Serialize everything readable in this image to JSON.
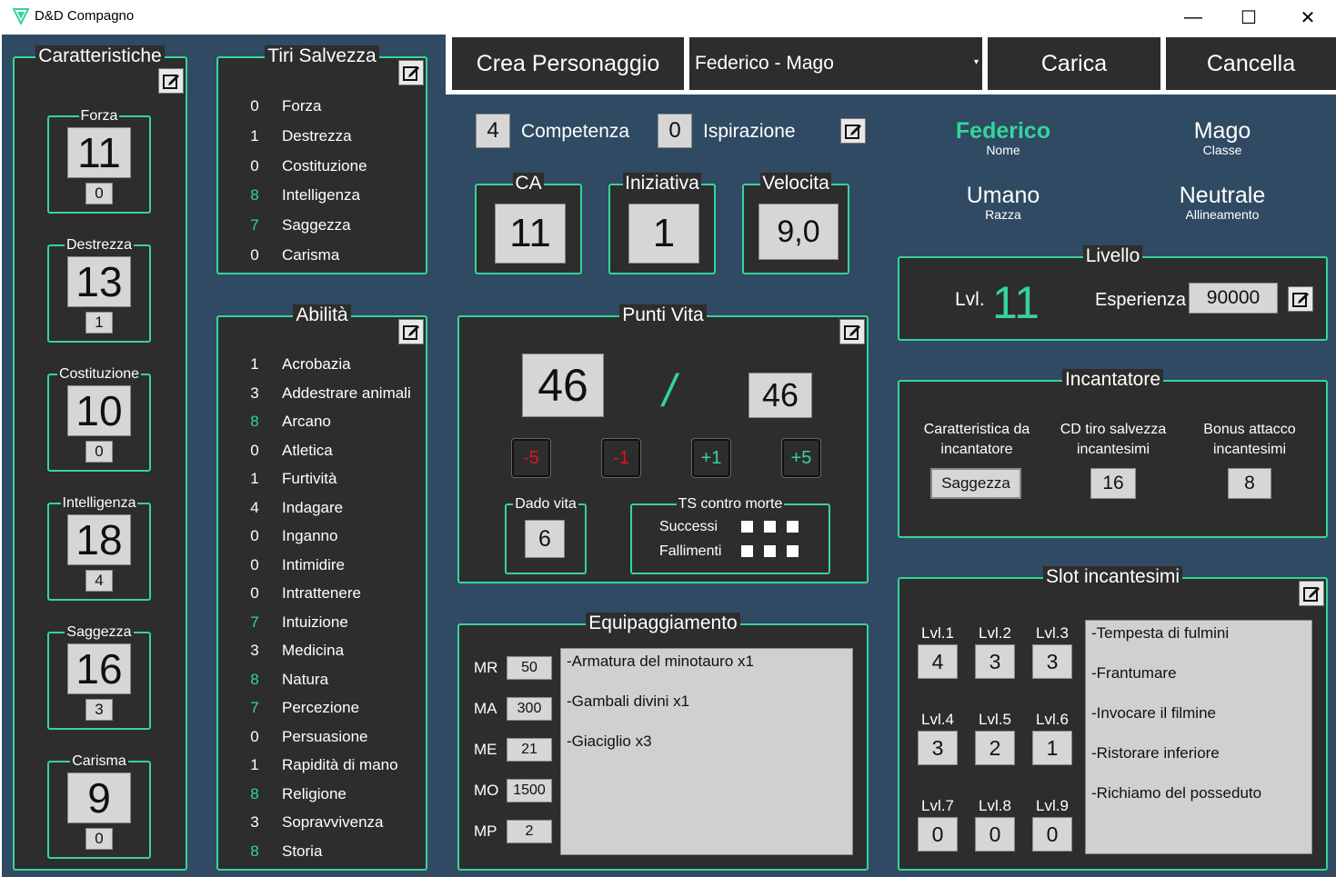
{
  "app": {
    "title": "D&D Compagno",
    "minimize": "—",
    "maximize": "☐",
    "close": "✕"
  },
  "colors": {
    "accent": "#35d49a",
    "background": "#2f4a62",
    "panel": "#2d2d2d",
    "negative": "#e0141b"
  },
  "caratteristiche": {
    "title": "Caratteristiche",
    "stats": [
      {
        "label": "Forza",
        "value": "11",
        "mod": "0"
      },
      {
        "label": "Destrezza",
        "value": "13",
        "mod": "1"
      },
      {
        "label": "Costituzione",
        "value": "10",
        "mod": "0"
      },
      {
        "label": "Intelligenza",
        "value": "18",
        "mod": "4"
      },
      {
        "label": "Saggezza",
        "value": "16",
        "mod": "3"
      },
      {
        "label": "Carisma",
        "value": "9",
        "mod": "0"
      }
    ]
  },
  "tiri_salvezza": {
    "title": "Tiri Salvezza",
    "items": [
      {
        "value": "0",
        "label": "Forza",
        "proficient": false
      },
      {
        "value": "1",
        "label": "Destrezza",
        "proficient": false
      },
      {
        "value": "0",
        "label": "Costituzione",
        "proficient": false
      },
      {
        "value": "8",
        "label": "Intelligenza",
        "proficient": true
      },
      {
        "value": "7",
        "label": "Saggezza",
        "proficient": true
      },
      {
        "value": "0",
        "label": "Carisma",
        "proficient": false
      }
    ]
  },
  "abilita": {
    "title": "Abilità",
    "items": [
      {
        "value": "1",
        "label": "Acrobazia",
        "proficient": false
      },
      {
        "value": "3",
        "label": "Addestrare animali",
        "proficient": false
      },
      {
        "value": "8",
        "label": "Arcano",
        "proficient": true
      },
      {
        "value": "0",
        "label": "Atletica",
        "proficient": false
      },
      {
        "value": "1",
        "label": "Furtività",
        "proficient": false
      },
      {
        "value": "4",
        "label": "Indagare",
        "proficient": false
      },
      {
        "value": "0",
        "label": "Inganno",
        "proficient": false
      },
      {
        "value": "0",
        "label": "Intimidire",
        "proficient": false
      },
      {
        "value": "0",
        "label": "Intrattenere",
        "proficient": false
      },
      {
        "value": "7",
        "label": "Intuizione",
        "proficient": true
      },
      {
        "value": "3",
        "label": "Medicina",
        "proficient": false
      },
      {
        "value": "8",
        "label": "Natura",
        "proficient": true
      },
      {
        "value": "7",
        "label": "Percezione",
        "proficient": true
      },
      {
        "value": "0",
        "label": "Persuasione",
        "proficient": false
      },
      {
        "value": "1",
        "label": "Rapidità di mano",
        "proficient": false
      },
      {
        "value": "8",
        "label": "Religione",
        "proficient": true
      },
      {
        "value": "3",
        "label": "Sopravvivenza",
        "proficient": false
      },
      {
        "value": "8",
        "label": "Storia",
        "proficient": true
      }
    ]
  },
  "toolbar": {
    "crea": "Crea Personaggio",
    "selected_character": "Federico - Mago",
    "carica": "Carica",
    "cancella": "Cancella"
  },
  "competenza": {
    "value": "4",
    "label": "Competenza"
  },
  "ispirazione": {
    "value": "0",
    "label": "Ispirazione"
  },
  "combat": {
    "ca": {
      "label": "CA",
      "value": "11"
    },
    "iniziativa": {
      "label": "Iniziativa",
      "value": "1"
    },
    "velocita": {
      "label": "Velocita",
      "value": "9,0"
    }
  },
  "character": {
    "nome": "Federico",
    "nome_label": "Nome",
    "classe": "Mago",
    "classe_label": "Classe",
    "razza": "Umano",
    "razza_label": "Razza",
    "allineamento": "Neutrale",
    "allineamento_label": "Allineamento"
  },
  "livello": {
    "title": "Livello",
    "lvl_label": "Lvl.",
    "lvl": "11",
    "exp_label": "Esperienza",
    "exp": "90000"
  },
  "punti_vita": {
    "title": "Punti Vita",
    "current": "46",
    "separator": "/",
    "max": "46",
    "buttons": [
      "-5",
      "-1",
      "+1",
      "+5"
    ],
    "dado_label": "Dado vita",
    "dado": "6",
    "ts_title": "TS contro morte",
    "successi": "Successi",
    "fallimenti": "Fallimenti"
  },
  "incantatore": {
    "title": "Incantatore",
    "car_label": "Caratteristica da incantatore",
    "car_value": "Saggezza",
    "cd_label": "CD tiro salvezza incantesimi",
    "cd_value": "16",
    "bonus_label": "Bonus attacco incantesimi",
    "bonus_value": "8"
  },
  "equipaggiamento": {
    "title": "Equipaggiamento",
    "money": [
      {
        "label": "MR",
        "value": "50"
      },
      {
        "label": "MA",
        "value": "300"
      },
      {
        "label": "ME",
        "value": "21"
      },
      {
        "label": "MO",
        "value": "1500"
      },
      {
        "label": "MP",
        "value": "2"
      }
    ],
    "items": [
      "-Armatura del minotauro x1",
      "-Gambali divini x1",
      "-Giaciglio x3"
    ]
  },
  "slot": {
    "title": "Slot incantesimi",
    "levels": [
      {
        "label": "Lvl.1",
        "value": "4"
      },
      {
        "label": "Lvl.2",
        "value": "3"
      },
      {
        "label": "Lvl.3",
        "value": "3"
      },
      {
        "label": "Lvl.4",
        "value": "3"
      },
      {
        "label": "Lvl.5",
        "value": "2"
      },
      {
        "label": "Lvl.6",
        "value": "1"
      },
      {
        "label": "Lvl.7",
        "value": "0"
      },
      {
        "label": "Lvl.8",
        "value": "0"
      },
      {
        "label": "Lvl.9",
        "value": "0"
      }
    ],
    "spells": [
      "-Tempesta di fulmini",
      "-Frantumare",
      "-Invocare il filmine",
      "-Ristorare inferiore",
      "-Richiamo del posseduto"
    ]
  },
  "icons": {
    "edit": "edit-icon",
    "app": "app-logo-icon",
    "dropdown": "dropdown-arrow-icon"
  }
}
